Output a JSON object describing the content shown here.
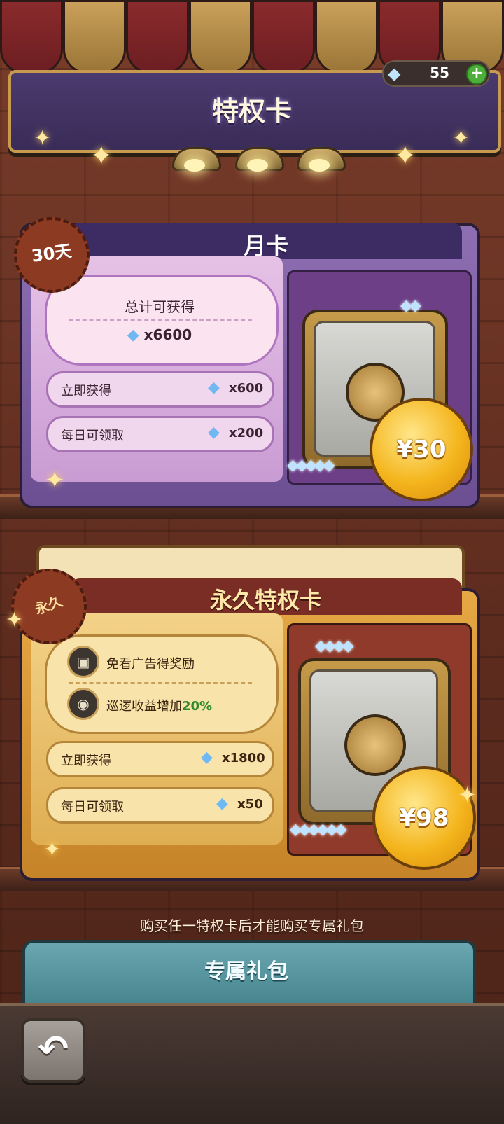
{
  "header": {
    "title": "特权卡",
    "currency": {
      "icon": "diamond-icon",
      "value": "55",
      "add_icon": "plus-icon"
    }
  },
  "monthly_card": {
    "badge": "30天",
    "title": "月卡",
    "total_label": "总计可获得",
    "total_value": "x6600",
    "rows": [
      {
        "label": "立即获得",
        "value": "x600"
      },
      {
        "label": "每日可领取",
        "value": "x200"
      }
    ],
    "price": "¥30"
  },
  "permanent_card": {
    "badge": "永久",
    "title": "永久特权卡",
    "perks": [
      {
        "icon": "no-ads-icon",
        "text": "免看广告得奖励"
      },
      {
        "icon": "patrol-icon",
        "text": "巡逻收益增加",
        "highlight": "20%"
      }
    ],
    "rows": [
      {
        "label": "立即获得",
        "value": "x1800"
      },
      {
        "label": "每日可领取",
        "value": "x50"
      }
    ],
    "price": "¥98"
  },
  "notice": "购买任一特权卡后才能购买专属礼包",
  "exclusive_pack": {
    "title": "专属礼包"
  },
  "colors": {
    "highlight_green": "#2f8a2a",
    "accent_gold": "#f4b51d"
  },
  "footer": {
    "back_icon": "back-arrow-icon"
  }
}
